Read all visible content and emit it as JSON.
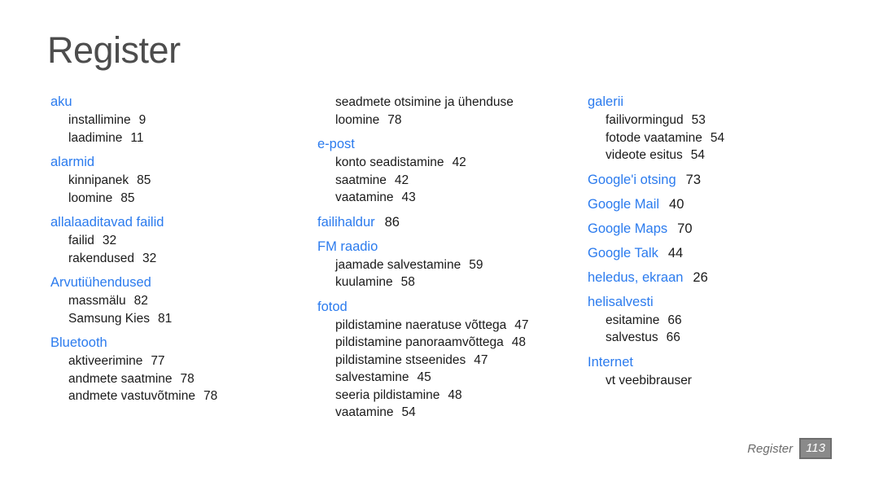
{
  "title": "Register",
  "colors": {
    "heading_blue": "#2b7bee",
    "title_gray": "#4d4d4d",
    "body_black": "#1a1a1a",
    "badge_fill": "#8a8a8a",
    "badge_border": "#6e6e6e"
  },
  "footer": {
    "label": "Register",
    "page_number": "113"
  },
  "columns": [
    {
      "entries": [
        {
          "type": "head",
          "label": "aku",
          "page": ""
        },
        {
          "type": "sub",
          "label": "installimine",
          "page": "9"
        },
        {
          "type": "sub",
          "label": "laadimine",
          "page": "11"
        },
        {
          "type": "head",
          "label": "alarmid",
          "page": ""
        },
        {
          "type": "sub",
          "label": "kinnipanek",
          "page": "85"
        },
        {
          "type": "sub",
          "label": "loomine",
          "page": "85"
        },
        {
          "type": "head",
          "label": "allalaaditavad failid",
          "page": ""
        },
        {
          "type": "sub",
          "label": "failid",
          "page": "32"
        },
        {
          "type": "sub",
          "label": "rakendused",
          "page": "32"
        },
        {
          "type": "head",
          "label": "Arvutiühendused",
          "page": ""
        },
        {
          "type": "sub",
          "label": "massmälu",
          "page": "82"
        },
        {
          "type": "sub",
          "label": "Samsung Kies",
          "page": "81"
        },
        {
          "type": "head",
          "label": "Bluetooth",
          "page": ""
        },
        {
          "type": "sub",
          "label": "aktiveerimine",
          "page": "77"
        },
        {
          "type": "sub",
          "label": "andmete saatmine",
          "page": "78"
        },
        {
          "type": "sub",
          "label": "andmete vastuvõtmine",
          "page": "78"
        }
      ]
    },
    {
      "entries": [
        {
          "type": "sub",
          "label": "seadmete otsimine ja ühenduse",
          "page": ""
        },
        {
          "type": "sub",
          "label": "loomine",
          "page": "78"
        },
        {
          "type": "head",
          "label": "e-post",
          "page": ""
        },
        {
          "type": "sub",
          "label": "konto seadistamine",
          "page": "42"
        },
        {
          "type": "sub",
          "label": "saatmine",
          "page": "42"
        },
        {
          "type": "sub",
          "label": "vaatamine",
          "page": "43"
        },
        {
          "type": "head",
          "label": "failihaldur",
          "page": "86"
        },
        {
          "type": "head",
          "label": "FM raadio",
          "page": ""
        },
        {
          "type": "sub",
          "label": "jaamade salvestamine",
          "page": "59"
        },
        {
          "type": "sub",
          "label": "kuulamine",
          "page": "58"
        },
        {
          "type": "head",
          "label": "fotod",
          "page": ""
        },
        {
          "type": "sub",
          "label": "pildistamine naeratuse võttega",
          "page": "47"
        },
        {
          "type": "sub",
          "label": "pildistamine panoraamvõttega",
          "page": "48"
        },
        {
          "type": "sub",
          "label": "pildistamine stseenides",
          "page": "47"
        },
        {
          "type": "sub",
          "label": "salvestamine",
          "page": "45"
        },
        {
          "type": "sub",
          "label": "seeria pildistamine",
          "page": "48"
        },
        {
          "type": "sub",
          "label": "vaatamine",
          "page": "54"
        }
      ]
    },
    {
      "entries": [
        {
          "type": "head",
          "label": "galerii",
          "page": ""
        },
        {
          "type": "sub",
          "label": "failivormingud",
          "page": "53"
        },
        {
          "type": "sub",
          "label": "fotode vaatamine",
          "page": "54"
        },
        {
          "type": "sub",
          "label": "videote esitus",
          "page": "54"
        },
        {
          "type": "head",
          "label": "Google'i otsing",
          "page": "73"
        },
        {
          "type": "head",
          "label": "Google Mail",
          "page": "40"
        },
        {
          "type": "head",
          "label": "Google Maps",
          "page": "70"
        },
        {
          "type": "head",
          "label": "Google Talk",
          "page": "44"
        },
        {
          "type": "head",
          "label": "heledus, ekraan",
          "page": "26"
        },
        {
          "type": "head",
          "label": "helisalvesti",
          "page": ""
        },
        {
          "type": "sub",
          "label": "esitamine",
          "page": "66"
        },
        {
          "type": "sub",
          "label": "salvestus",
          "page": "66"
        },
        {
          "type": "head",
          "label": "Internet",
          "page": ""
        },
        {
          "type": "sub",
          "label": "vt veebibrauser",
          "page": ""
        }
      ]
    }
  ]
}
